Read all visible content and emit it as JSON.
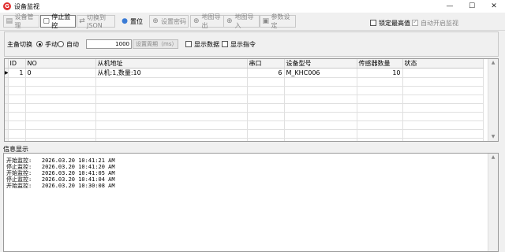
{
  "window": {
    "title": "设备监视",
    "controls": {
      "minimize": "—",
      "maximize": "☐",
      "close": "✕"
    }
  },
  "toolbar": {
    "device_mgmt": "设备管理",
    "stop_monitor": "停止监控",
    "switch_to_json": "切换到JSON",
    "reset": "置位",
    "set_password": "设置密码",
    "map_export": "地图导出",
    "map_import": "地图导入",
    "param_settings": "参数设定",
    "lock_max": "锁定最高值",
    "auto_start_monitor": "自动开启监视"
  },
  "controls_panel": {
    "master_switch_label": "主备切换",
    "manual": "手动",
    "auto": "自动",
    "interval_value": "1000",
    "set_interval_button": "设置周期（ms）",
    "show_data": "显示数据",
    "show_command": "显示指令"
  },
  "table": {
    "columns": [
      "ID",
      "NO",
      "从机地址",
      "串口",
      "设备型号",
      "传感器数量",
      "状态"
    ],
    "rows": [
      {
        "id": "1",
        "no": "0",
        "slave": "从机:1,数量:10",
        "port": "6",
        "model": "M_KHC006",
        "sensors": "10",
        "status": ""
      }
    ]
  },
  "info": {
    "label": "信息显示",
    "lines": [
      "开始监控:   2026.03.20 10:41:21 AM",
      "停止监控:   2026.03.20 10:41:20 AM",
      "开始监控:   2026.03.20 10:41:05 AM",
      "停止监控:   2026.03.20 10:41:04 AM",
      "开始监控:   2026.03.20 10:30:08 AM"
    ]
  },
  "colors": {
    "app_icon": "#e03030",
    "window_bg": "#f0f0f0"
  }
}
